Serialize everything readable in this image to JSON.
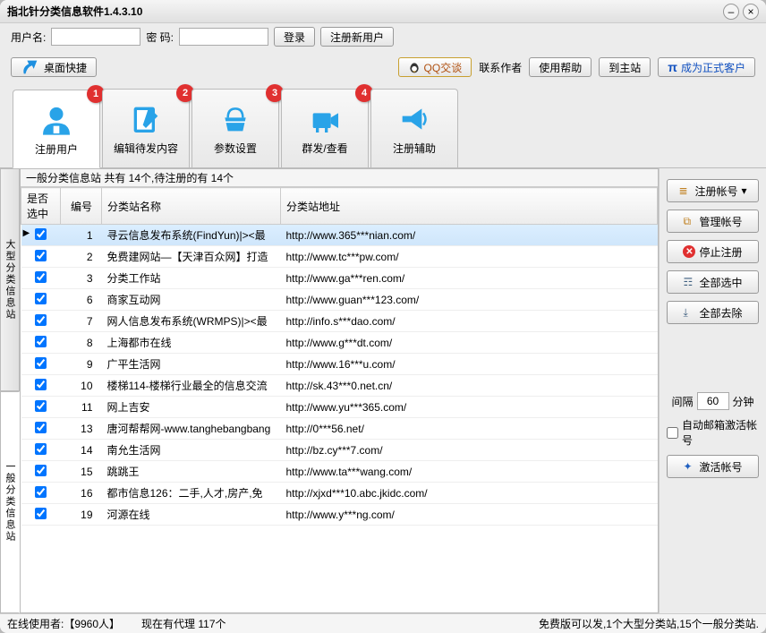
{
  "window": {
    "title": "指北针分类信息软件1.4.3.10"
  },
  "login": {
    "username_label": "用户名:",
    "password_label": "密   码:",
    "login_btn": "登录",
    "register_btn": "注册新用户"
  },
  "toolbar": {
    "desktop_shortcut": "桌面快捷",
    "qq_contact": "QQ交谈",
    "qq_suffix": "联系作者",
    "help": "使用帮助",
    "to_main": "到主站",
    "become_customer": "成为正式客户"
  },
  "tabs": {
    "items": [
      {
        "label": "注册用户",
        "badge": "1"
      },
      {
        "label": "编辑待发内容",
        "badge": "2"
      },
      {
        "label": "参数设置",
        "badge": "3"
      },
      {
        "label": "群发/查看",
        "badge": "4"
      },
      {
        "label": "注册辅助",
        "badge": ""
      }
    ]
  },
  "vtabs": {
    "large": "大型分类信息站",
    "normal": "一般分类信息站"
  },
  "summary": "一般分类信息站 共有 14个,待注册的有 14个",
  "table": {
    "headers": {
      "sel": "是否选中",
      "id": "编号",
      "name": "分类站名称",
      "url": "分类站地址"
    },
    "rows": [
      {
        "id": "1",
        "name": "寻云信息发布系统(FindYun)|><最",
        "url": "http://www.365***nian.com/"
      },
      {
        "id": "2",
        "name": "免费建网站—【天津百众网】打造",
        "url": "http://www.tc***pw.com/"
      },
      {
        "id": "3",
        "name": "分类工作站",
        "url": "http://www.ga***ren.com/"
      },
      {
        "id": "6",
        "name": "商家互动网",
        "url": "http://www.guan***123.com/"
      },
      {
        "id": "7",
        "name": "网人信息发布系统(WRMPS)|><最",
        "url": "http://info.s***dao.com/"
      },
      {
        "id": "8",
        "name": "上海都市在线",
        "url": "http://www.g***dt.com/"
      },
      {
        "id": "9",
        "name": "广平生活网",
        "url": "http://www.16***u.com/"
      },
      {
        "id": "10",
        "name": "楼梯114-楼梯行业最全的信息交流",
        "url": "http://sk.43***0.net.cn/"
      },
      {
        "id": "11",
        "name": "网上吉安",
        "url": "http://www.yu***365.com/"
      },
      {
        "id": "13",
        "name": "唐河帮帮网-www.tanghebangbang",
        "url": "http://0***56.net/"
      },
      {
        "id": "14",
        "name": "南允生活网",
        "url": "http://bz.cy***7.com/"
      },
      {
        "id": "15",
        "name": "跳跳王",
        "url": "http://www.ta***wang.com/"
      },
      {
        "id": "16",
        "name": "都市信息126：二手,人才,房产,免",
        "url": "http://xjxd***10.abc.jkidc.com/"
      },
      {
        "id": "19",
        "name": "河源在线",
        "url": "http://www.y***ng.com/"
      }
    ]
  },
  "sidepane": {
    "register_account": "注册帐号",
    "manage_account": "管理帐号",
    "stop_register": "停止注册",
    "select_all": "全部选中",
    "remove_all": "全部去除",
    "interval_label": "间隔",
    "interval_value": "60",
    "interval_unit": "分钟",
    "auto_mail": "自动邮箱激活帐号",
    "activate_account": "激活帐号"
  },
  "statusbar": {
    "online": "在线使用者:【9960人】",
    "agents": "现在有代理 117个",
    "version_note": "免费版可以发,1个大型分类站,15个一般分类站."
  }
}
